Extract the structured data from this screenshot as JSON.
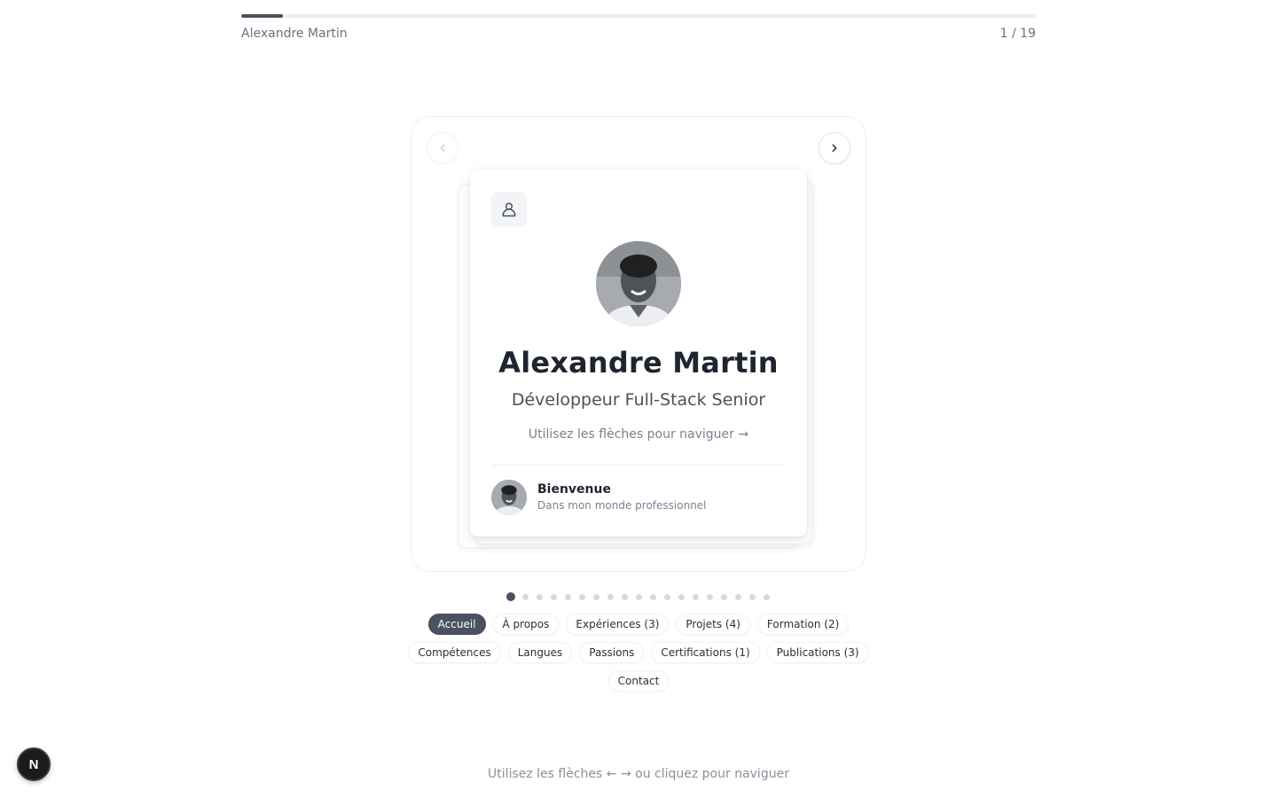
{
  "header": {
    "progress_fraction": 0.0526,
    "owner_name": "Alexandre Martin",
    "page_counter": "1 / 19"
  },
  "card": {
    "icon": "user-icon",
    "name": "Alexandre Martin",
    "title": "Développeur Full-Stack Senior",
    "hint": "Utilisez les flèches pour naviguer →",
    "footer": {
      "title": "Bienvenue",
      "subtitle": "Dans mon monde professionnel"
    }
  },
  "navigation": {
    "prev_icon": "chevron-left-icon",
    "next_icon": "chevron-right-icon",
    "total_slides": 19,
    "current_slide": 1
  },
  "sections": [
    [
      {
        "label": "Accueil",
        "active": true
      },
      {
        "label": "À propos",
        "active": false
      },
      {
        "label": "Expériences (3)",
        "active": false
      },
      {
        "label": "Projets (4)",
        "active": false
      },
      {
        "label": "Formation (2)",
        "active": false
      }
    ],
    [
      {
        "label": "Compétences",
        "active": false
      },
      {
        "label": "Langues",
        "active": false
      },
      {
        "label": "Passions",
        "active": false
      },
      {
        "label": "Certifications (1)",
        "active": false
      },
      {
        "label": "Publications (3)",
        "active": false
      }
    ],
    [
      {
        "label": "Contact",
        "active": false
      }
    ]
  ],
  "footer_hint": "Utilisez les flèches ← → ou cliquez pour naviguer",
  "dev_badge": "N",
  "colors": {
    "accent": "#4a5160",
    "inactive_dot": "#d6d9de",
    "text_muted": "#7b8190"
  }
}
